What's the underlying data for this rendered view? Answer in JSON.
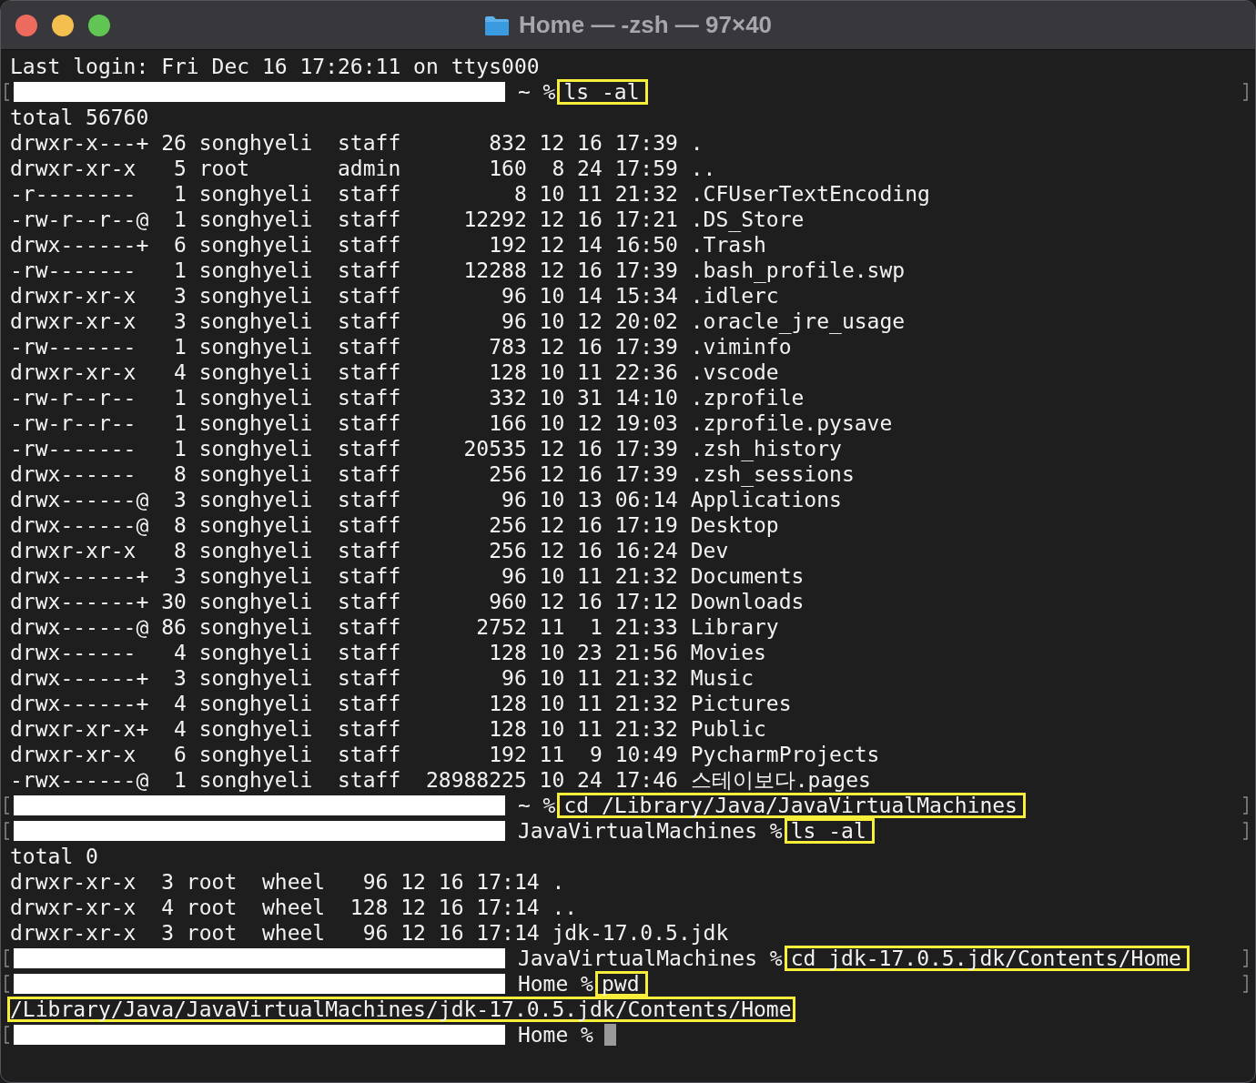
{
  "window": {
    "title": "Home — -zsh — 97×40"
  },
  "lines": [
    {
      "kind": "output",
      "text": "Last login: Fri Dec 16 17:26:11 on ttys000"
    },
    {
      "kind": "prompt",
      "path": "~ %",
      "command": "ls -al",
      "highlighted": true
    },
    {
      "kind": "output",
      "text": "total 56760"
    },
    {
      "kind": "output",
      "text": "drwxr-x---+ 26 songhyeli  staff       832 12 16 17:39 ."
    },
    {
      "kind": "output",
      "text": "drwxr-xr-x   5 root       admin       160  8 24 17:59 .."
    },
    {
      "kind": "output",
      "text": "-r--------   1 songhyeli  staff         8 10 11 21:32 .CFUserTextEncoding"
    },
    {
      "kind": "output",
      "text": "-rw-r--r--@  1 songhyeli  staff     12292 12 16 17:21 .DS_Store"
    },
    {
      "kind": "output",
      "text": "drwx------+  6 songhyeli  staff       192 12 14 16:50 .Trash"
    },
    {
      "kind": "output",
      "text": "-rw-------   1 songhyeli  staff     12288 12 16 17:39 .bash_profile.swp"
    },
    {
      "kind": "output",
      "text": "drwxr-xr-x   3 songhyeli  staff        96 10 14 15:34 .idlerc"
    },
    {
      "kind": "output",
      "text": "drwxr-xr-x   3 songhyeli  staff        96 10 12 20:02 .oracle_jre_usage"
    },
    {
      "kind": "output",
      "text": "-rw-------   1 songhyeli  staff       783 12 16 17:39 .viminfo"
    },
    {
      "kind": "output",
      "text": "drwxr-xr-x   4 songhyeli  staff       128 10 11 22:36 .vscode"
    },
    {
      "kind": "output",
      "text": "-rw-r--r--   1 songhyeli  staff       332 10 31 14:10 .zprofile"
    },
    {
      "kind": "output",
      "text": "-rw-r--r--   1 songhyeli  staff       166 10 12 19:03 .zprofile.pysave"
    },
    {
      "kind": "output",
      "text": "-rw-------   1 songhyeli  staff     20535 12 16 17:39 .zsh_history"
    },
    {
      "kind": "output",
      "text": "drwx------   8 songhyeli  staff       256 12 16 17:39 .zsh_sessions"
    },
    {
      "kind": "output",
      "text": "drwx------@  3 songhyeli  staff        96 10 13 06:14 Applications"
    },
    {
      "kind": "output",
      "text": "drwx------@  8 songhyeli  staff       256 12 16 17:19 Desktop"
    },
    {
      "kind": "output",
      "text": "drwxr-xr-x   8 songhyeli  staff       256 12 16 16:24 Dev"
    },
    {
      "kind": "output",
      "text": "drwx------+  3 songhyeli  staff        96 10 11 21:32 Documents"
    },
    {
      "kind": "output",
      "text": "drwx------+ 30 songhyeli  staff       960 12 16 17:12 Downloads"
    },
    {
      "kind": "output",
      "text": "drwx------@ 86 songhyeli  staff      2752 11  1 21:33 Library"
    },
    {
      "kind": "output",
      "text": "drwx------   4 songhyeli  staff       128 10 23 21:56 Movies"
    },
    {
      "kind": "output",
      "text": "drwx------+  3 songhyeli  staff        96 10 11 21:32 Music"
    },
    {
      "kind": "output",
      "text": "drwx------+  4 songhyeli  staff       128 10 11 21:32 Pictures"
    },
    {
      "kind": "output",
      "text": "drwxr-xr-x+  4 songhyeli  staff       128 10 11 21:32 Public"
    },
    {
      "kind": "output",
      "text": "drwxr-xr-x   6 songhyeli  staff       192 11  9 10:49 PycharmProjects"
    },
    {
      "kind": "output",
      "text": "-rwx------@  1 songhyeli  staff  28988225 10 24 17:46 스테이보다.pages"
    },
    {
      "kind": "prompt",
      "path": "~ %",
      "command": "cd /Library/Java/JavaVirtualMachines",
      "highlighted": true
    },
    {
      "kind": "prompt",
      "path": "JavaVirtualMachines %",
      "command": "ls -al",
      "highlighted": true
    },
    {
      "kind": "output",
      "text": "total 0"
    },
    {
      "kind": "output",
      "text": "drwxr-xr-x  3 root  wheel   96 12 16 17:14 ."
    },
    {
      "kind": "output",
      "text": "drwxr-xr-x  4 root  wheel  128 12 16 17:14 .."
    },
    {
      "kind": "output",
      "text": "drwxr-xr-x  3 root  wheel   96 12 16 17:14 jdk-17.0.5.jdk"
    },
    {
      "kind": "prompt",
      "path": "JavaVirtualMachines %",
      "command": "cd jdk-17.0.5.jdk/Contents/Home",
      "highlighted": true
    },
    {
      "kind": "prompt",
      "path": "Home %",
      "command": "pwd",
      "highlighted": true
    },
    {
      "kind": "output",
      "text": "/Library/Java/JavaVirtualMachines/jdk-17.0.5.jdk/Contents/Home",
      "highlighted": true
    },
    {
      "kind": "prompt",
      "path": "Home %",
      "cursor": true
    }
  ]
}
